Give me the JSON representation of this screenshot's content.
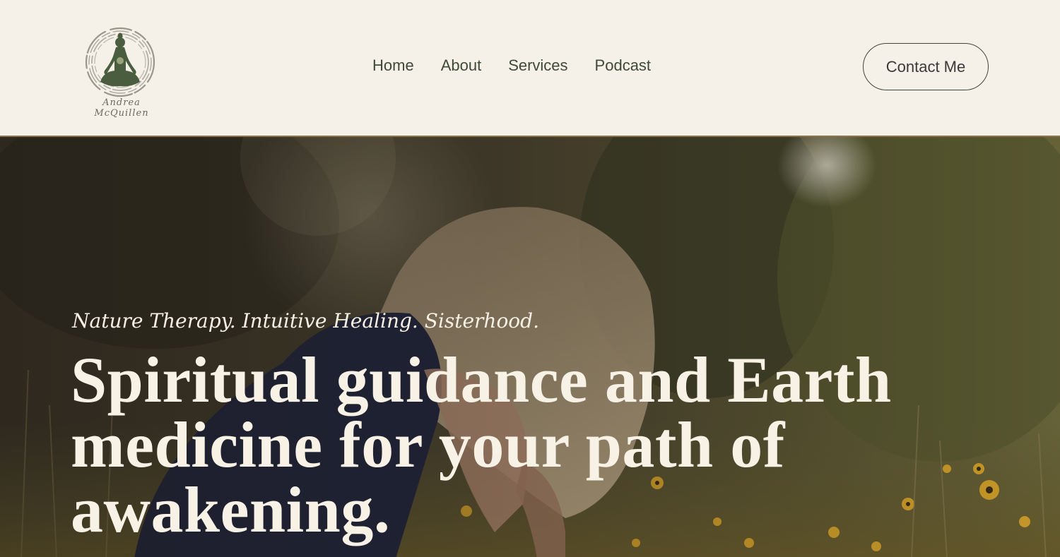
{
  "header": {
    "logo": {
      "icon": "meditating-woman-icon",
      "signature": "Andrea McQuillen"
    },
    "nav": [
      {
        "label": "Home"
      },
      {
        "label": "About"
      },
      {
        "label": "Services"
      },
      {
        "label": "Podcast"
      }
    ],
    "contact_label": "Contact Me"
  },
  "hero": {
    "tagline": "Nature Therapy. Intuitive Healing. Sisterhood.",
    "title": "Spiritual guidance and Earth medicine for your path of awakening."
  },
  "colors": {
    "background": "#f5f0e8",
    "nav_text": "#3f4a36",
    "logo_green": "#4a5e3f",
    "hero_text": "#f7f1e6"
  }
}
